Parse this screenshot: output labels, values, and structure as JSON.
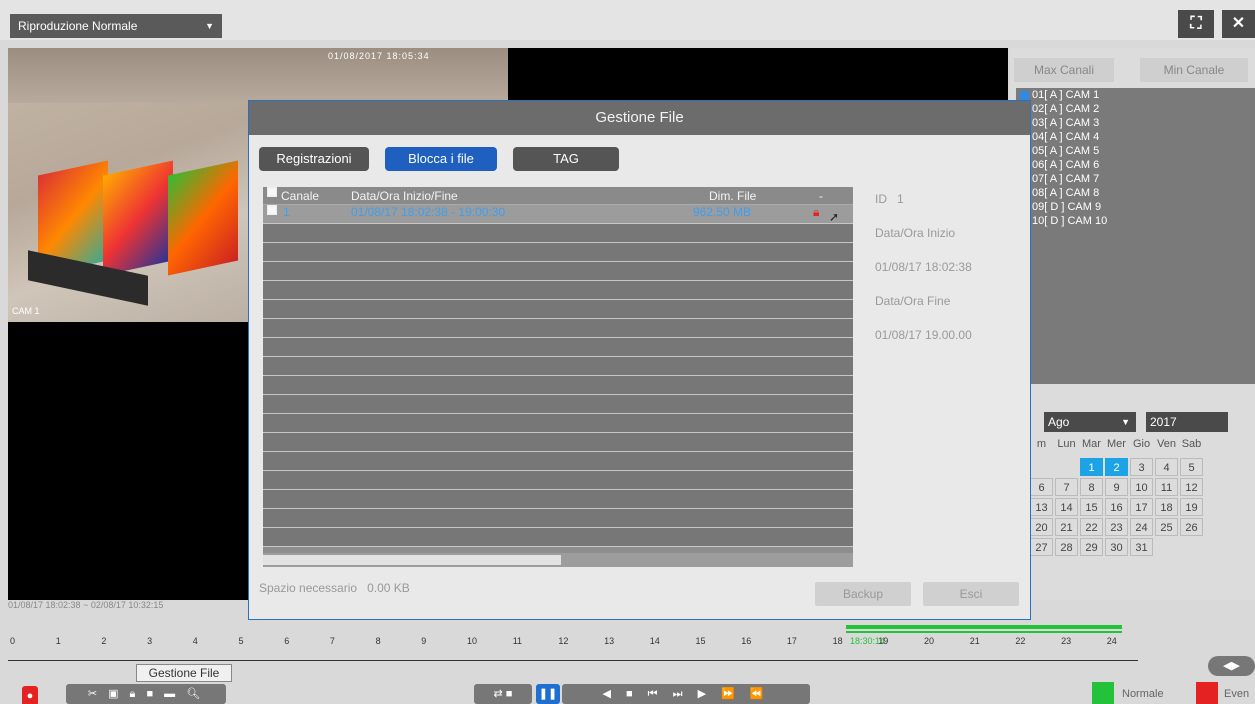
{
  "topbar": {
    "mode": "Riproduzione Normale",
    "fullscreen_icon": "fullscreen-icon",
    "close_icon": "close-icon"
  },
  "camera": {
    "osd_time": "01/08/2017 18:05:34",
    "name": "CAM 1"
  },
  "dialog": {
    "title": "Gestione File",
    "tabs": [
      "Registrazioni",
      "Blocca i file",
      "TAG"
    ],
    "active_tab": "Blocca i file",
    "columns": {
      "channel": "Canale",
      "datetime": "Data/Ora Inizio/Fine",
      "size": "Dim. File",
      "lock": "-"
    },
    "rows": [
      {
        "channel": "1",
        "datetime": "01/08/17 18:02:38 - 19:00:30",
        "size": "962.50 MB",
        "locked": true
      }
    ],
    "info": {
      "id_label": "ID",
      "id_value": "1",
      "start_label": "Data/Ora Inizio",
      "start_value": "01/08/17 18:02:38",
      "end_label": "Data/Ora Fine",
      "end_value": "01/08/17 19.00.00"
    },
    "space_label": "Spazio necessario",
    "space_value": "0.00 KB",
    "backup": "Backup",
    "exit": "Esci"
  },
  "right_panel": {
    "max_channels": "Max Canali",
    "min_channels": "Min Canale",
    "channels": [
      "01[ A ] CAM 1",
      "02[ A ] CAM 2",
      "03[ A ] CAM 3",
      "04[ A ] CAM 4",
      "05[ A ] CAM 5",
      "06[ A ] CAM 6",
      "07[ A ] CAM 7",
      "08[ A ] CAM 8",
      "09[ D ] CAM 9",
      "10[ D ] CAM 10"
    ],
    "month": "Ago",
    "year": "2017",
    "weekdays": [
      "m",
      "Lun",
      "Mar",
      "Mer",
      "Gio",
      "Ven",
      "Sab"
    ],
    "weeks": [
      [
        "",
        "",
        "1",
        "2",
        "3",
        "4",
        "5"
      ],
      [
        "6",
        "7",
        "8",
        "9",
        "10",
        "11",
        "12"
      ],
      [
        "13",
        "14",
        "15",
        "16",
        "17",
        "18",
        "19"
      ],
      [
        "20",
        "21",
        "22",
        "23",
        "24",
        "25",
        "26"
      ],
      [
        "27",
        "28",
        "29",
        "30",
        "31",
        "",
        ""
      ]
    ],
    "recorded_days": [
      "1",
      "2"
    ],
    "accent": "#1ca3e6"
  },
  "status": {
    "range": "01/08/17 18:02:38 ~ 02/08/17 10:32:15",
    "current_time": "18:30:14"
  },
  "timeline": {
    "ticks": [
      "0",
      "1",
      "2",
      "3",
      "4",
      "5",
      "6",
      "7",
      "8",
      "9",
      "10",
      "11",
      "12",
      "13",
      "14",
      "15",
      "16",
      "17",
      "18",
      "19",
      "20",
      "21",
      "22",
      "23",
      "24"
    ]
  },
  "tooltip": "Gestione File",
  "legend": {
    "normal": "Normale",
    "event": "Even",
    "normal_color": "#24c23a",
    "event_color": "#e52222"
  }
}
